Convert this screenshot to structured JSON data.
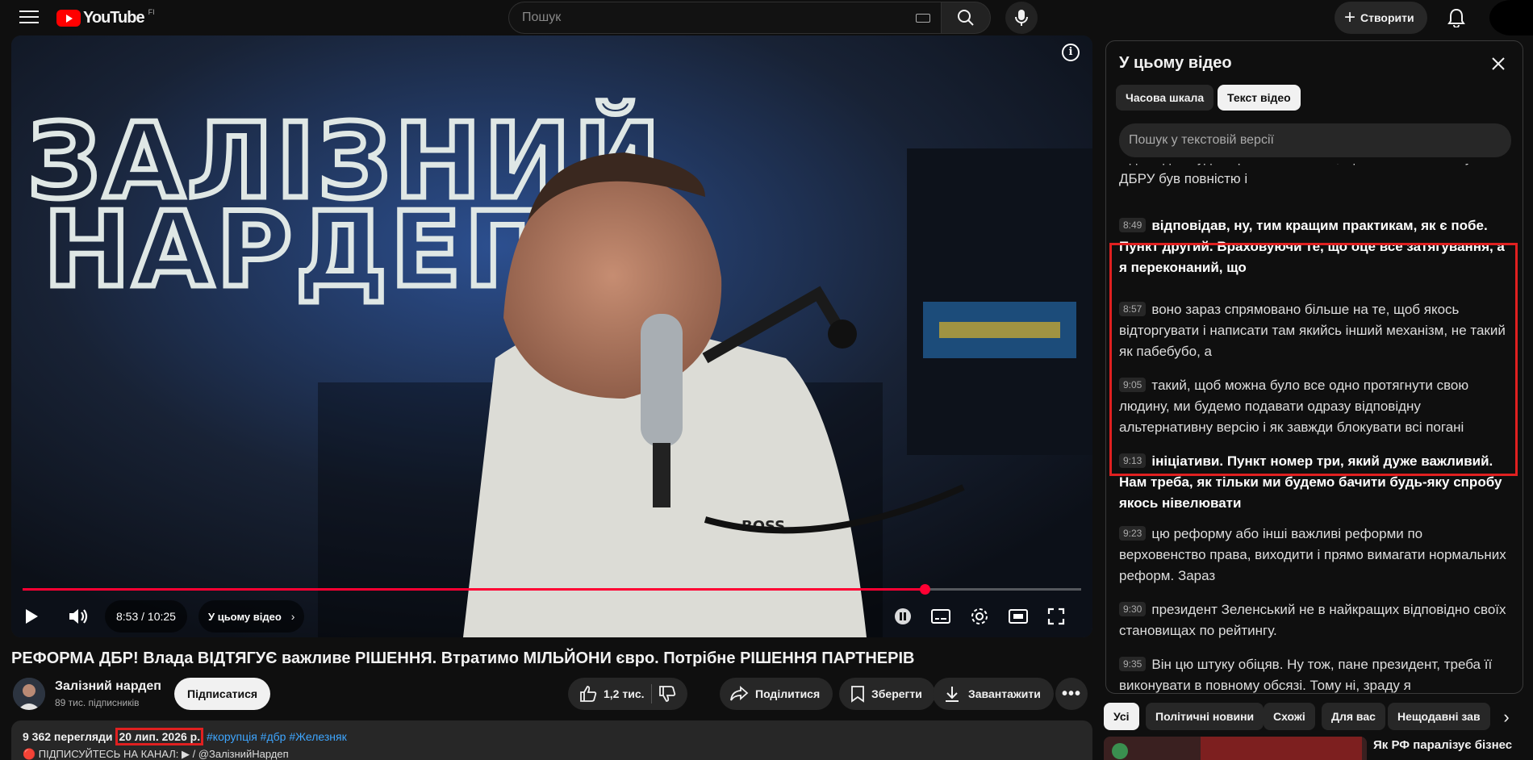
{
  "header": {
    "logo_text": "YouTube",
    "country_code": "FI",
    "search_placeholder": "Пошук",
    "create_label": "Створити"
  },
  "player": {
    "overlay_text_line1": "ЗАЛІЗНИЙ",
    "overlay_text_line2": "НАРДЕП",
    "shirt_text": "BOSS",
    "time": "8:53 / 10:25",
    "progress": 0.852,
    "chapter_label": "У цьому відео",
    "accent_color": "#ff0033"
  },
  "video": {
    "title": "РЕФОРМА ДБР! Влада ВІДТЯГУЄ важливе РІШЕННЯ. Втратимо МІЛЬЙОНИ євро. Потрібне РІШЕННЯ ПАРТНЕРІВ",
    "channel_name": "Залізний нардеп",
    "subscribers": "89 тис. підписників",
    "subscribe_label": "Підписатися",
    "likes": "1,2 тис.",
    "share_label": "Поділитися",
    "save_label": "Зберегти",
    "download_label": "Завантажити"
  },
  "description": {
    "views": "9 362 перегляди",
    "date": "20 лип. 2026 р.",
    "hashtags": "#корупція #дбр #Железняк",
    "line2": "🔴 ПІДПИСУЙТЕСЬ НА КАНАЛ: ▶ / @ЗалізнийНардеп"
  },
  "panel": {
    "title": "У цьому відео",
    "tab_chapters": "Часова шкала",
    "tab_transcript": "Текст відео",
    "search_placeholder": "Пошук у текстовій версії",
    "segments": [
      {
        "ts": "",
        "text": "відповідно буде спрямована на те, щоб текст по закону по ДБРУ був повністю і"
      },
      {
        "ts": "8:49",
        "text": "відповідав, ну, тим кращим практикам, як є побе. Пункт другий. Враховуючи те, що оце все затягування, а я переконаний, що"
      },
      {
        "ts": "8:57",
        "text": "воно зараз спрямовано більше на те, щоб якось відторгувати і написати там якийсь інший механізм, не такий як пабебубо, а"
      },
      {
        "ts": "9:05",
        "text": "такий, щоб можна було все одно протягнути свою людину, ми будемо подавати одразу відповідну альтернативну версію і як завжди блокувати всі погані"
      },
      {
        "ts": "9:13",
        "text": "ініціативи. Пункт номер три, який дуже важливий. Нам треба, як тільки ми будемо бачити будь-яку спробу якось нівелювати"
      },
      {
        "ts": "9:23",
        "text": "цю реформу або інші важливі реформи по верховенство права, виходити і прямо вимагати нормальних реформ. Зараз"
      },
      {
        "ts": "9:30",
        "text": "президент Зеленський не в найкращих відповідно своїх становищах по рейтингу."
      },
      {
        "ts": "9:35",
        "text": "Він цю штуку обіцяв. Ну тож, пане президент, треба її виконувати в повному обсязі. Тому ні, зраду я"
      }
    ]
  },
  "chips": [
    "Усі",
    "Політичні новини",
    "Схожі",
    "Для вас",
    "Нещодавні зав"
  ],
  "recommendation": {
    "title": "Як РФ паралізує бізнес"
  }
}
